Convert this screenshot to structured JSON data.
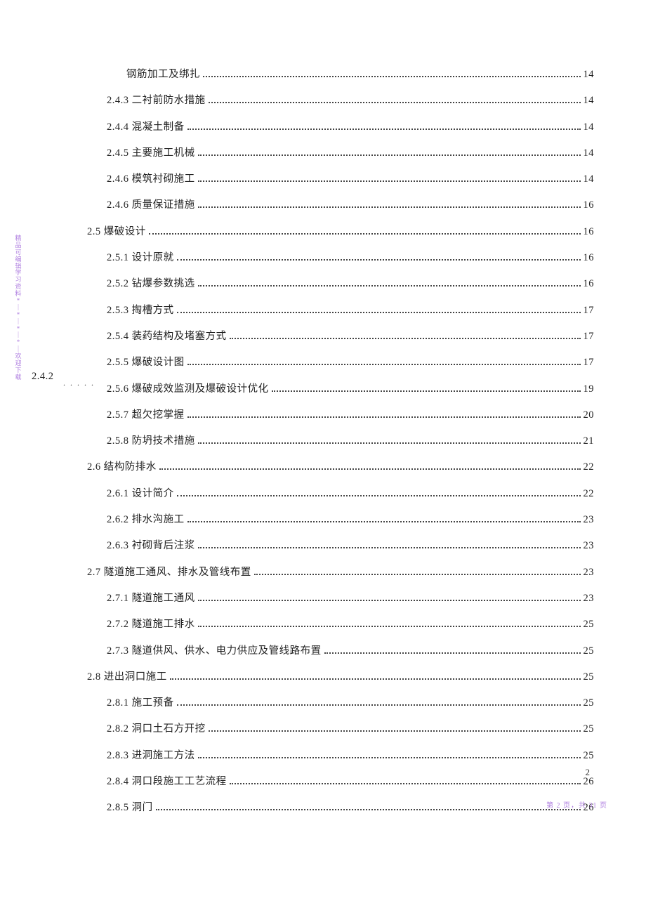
{
  "side_note": [
    "精",
    "品",
    "可",
    "编",
    "辑",
    "学",
    "习",
    "资",
    "料",
    "*",
    "｜",
    "*",
    "｜",
    "*",
    "｜",
    "*",
    "｜",
    "欢",
    "迎",
    "下",
    "载"
  ],
  "stray": {
    "label": "2.4.2"
  },
  "toc": [
    {
      "indent": 3,
      "label": "钢筋加工及绑扎",
      "page": "14"
    },
    {
      "indent": 2,
      "label": "2.4.3 二衬前防水措施",
      "page": "14"
    },
    {
      "indent": 2,
      "label": "2.4.4  混凝土制备",
      "page": "14"
    },
    {
      "indent": 2,
      "label": "2.4.5  主要施工机械",
      "page": "14"
    },
    {
      "indent": 2,
      "label": "2.4.6  模筑衬砌施工",
      "page": "14"
    },
    {
      "indent": 2,
      "label": "2.4.6  质量保证措施",
      "page": "16"
    },
    {
      "indent": 1,
      "label": "2.5 爆破设计",
      "page": "16"
    },
    {
      "indent": 2,
      "label": "2.5.1 设计原就",
      "page": "16"
    },
    {
      "indent": 2,
      "label": "2.5.2 钻爆参数挑选",
      "page": "16"
    },
    {
      "indent": 2,
      "label": "2.5.3 掏槽方式",
      "page": "17"
    },
    {
      "indent": 2,
      "label": "2.5.4 装药结构及堵塞方式",
      "page": "17"
    },
    {
      "indent": 2,
      "label": "2.5.5 爆破设计图",
      "page": "17"
    },
    {
      "indent": 2,
      "label": "2.5.6 爆破成效监测及爆破设计优化",
      "page": "19"
    },
    {
      "indent": 2,
      "label": "2.5.7 超欠挖掌握",
      "page": "20"
    },
    {
      "indent": 2,
      "label": "2.5.8 防坍技术措施",
      "page": "21"
    },
    {
      "indent": 1,
      "label": "2.6 结构防排水",
      "page": "22"
    },
    {
      "indent": 2,
      "label": "2.6.1  设计简介",
      "page": "22"
    },
    {
      "indent": 2,
      "label": "2.6.2  排水沟施工",
      "page": "23"
    },
    {
      "indent": 2,
      "label": "2.6.3  衬砌背后注浆",
      "page": "23"
    },
    {
      "indent": 1,
      "label": "2.7 隧道施工通风、排水及管线布置",
      "page": "23"
    },
    {
      "indent": 2,
      "label": "2.7.1 隧道施工通风",
      "page": "23"
    },
    {
      "indent": 2,
      "label": "2.7.2 隧道施工排水",
      "page": "25"
    },
    {
      "indent": 2,
      "label": "2.7.3 隧道供风、供水、电力供应及管线路布置",
      "page": "25"
    },
    {
      "indent": 1,
      "label": "2.8 进出洞口施工",
      "page": "25"
    },
    {
      "indent": 2,
      "label": "2.8.1 施工预备",
      "page": "25"
    },
    {
      "indent": 2,
      "label": "2.8.2 洞口土石方开挖",
      "page": "25"
    },
    {
      "indent": 2,
      "label": "2.8.3  进洞施工方法",
      "page": "25"
    },
    {
      "indent": 2,
      "label": "2.8.4  洞口段施工工艺流程",
      "page": "26"
    },
    {
      "indent": 2,
      "label": "2.8.5  洞门",
      "page": "26"
    }
  ],
  "page_number_bottom": "2",
  "footer": "第 2 页，共 31 页"
}
